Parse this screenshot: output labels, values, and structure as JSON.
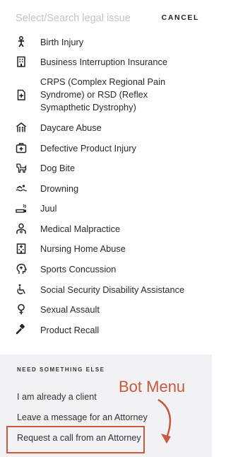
{
  "search": {
    "placeholder": "Select/Search legal issue",
    "value": ""
  },
  "cancel_label": "CANCEL",
  "items": [
    {
      "label": "Birth Injury",
      "icon": "baby-icon"
    },
    {
      "label": "Business Interruption Insurance",
      "icon": "building-icon"
    },
    {
      "label": "CRPS (Complex Regional Pain Syndrome) or RSD (Reflex Symapthetic Dystrophy)",
      "icon": "medical-document-icon"
    },
    {
      "label": "Daycare Abuse",
      "icon": "daycare-icon"
    },
    {
      "label": "Defective Product Injury",
      "icon": "first-aid-kit-icon"
    },
    {
      "label": "Dog Bite",
      "icon": "dog-icon"
    },
    {
      "label": "Drowning",
      "icon": "swimmer-icon"
    },
    {
      "label": "Juul",
      "icon": "vape-icon"
    },
    {
      "label": "Medical Malpractice",
      "icon": "doctor-icon"
    },
    {
      "label": "Nursing Home Abuse",
      "icon": "hospital-building-icon"
    },
    {
      "label": "Sports Concussion",
      "icon": "head-injury-icon"
    },
    {
      "label": "Social Security Disability Assistance",
      "icon": "wheelchair-icon"
    },
    {
      "label": "Sexual Assault",
      "icon": "female-symbol-icon"
    },
    {
      "label": "Product Recall",
      "icon": "gavel-icon"
    }
  ],
  "footer": {
    "title": "NEED SOMETHING ELSE",
    "links": [
      "I am already a client",
      "Leave a message for an Attorney",
      "Request a call from an Attorney"
    ]
  },
  "annotation": {
    "label": "Bot Menu",
    "color": "#c85a3a"
  }
}
